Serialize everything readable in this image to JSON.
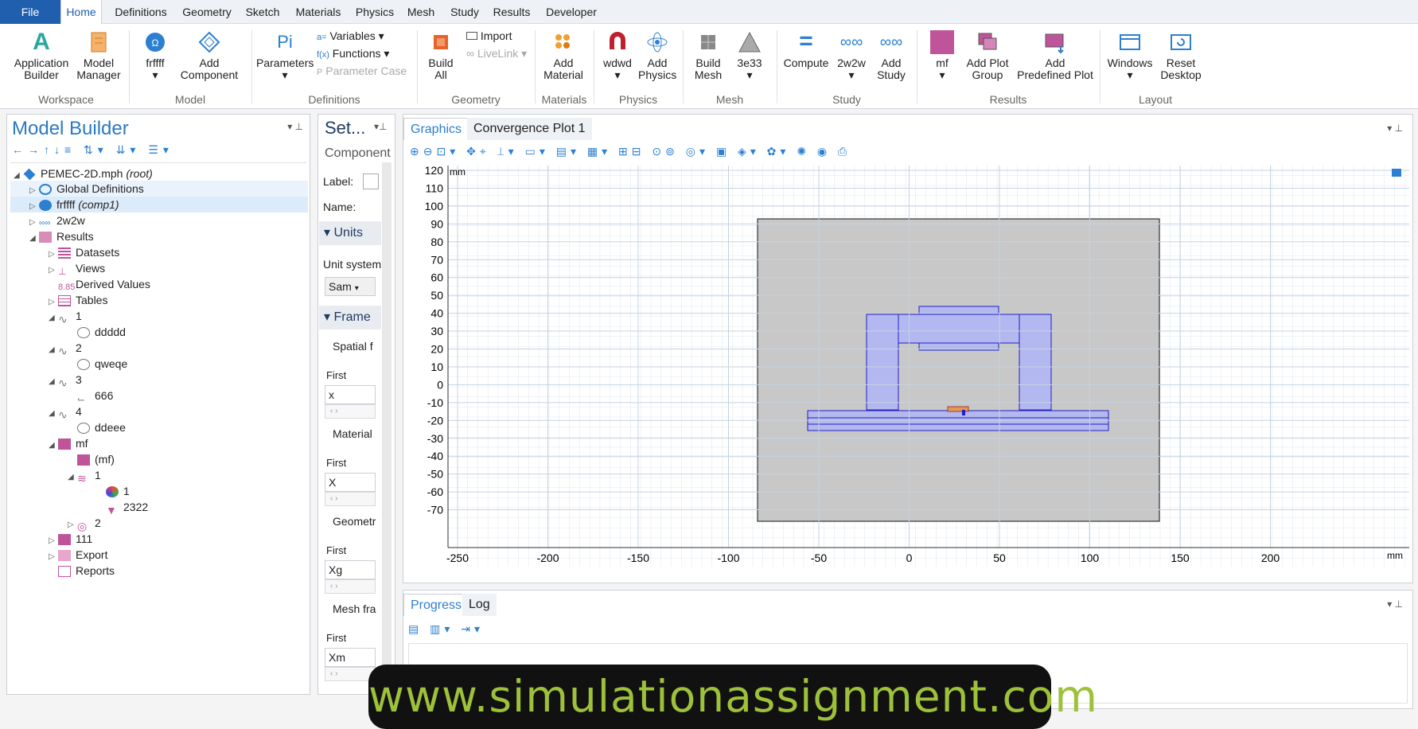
{
  "menu": {
    "tabs": [
      "File",
      "Home",
      "Definitions",
      "Geometry",
      "Sketch",
      "Materials",
      "Physics",
      "Mesh",
      "Study",
      "Results",
      "Developer"
    ]
  },
  "ribbon": {
    "application_builder": "Application\nBuilder",
    "model_manager": "Model\nManager",
    "component_name": "frffff",
    "add_component": "Add\nComponent",
    "parameters": "Parameters",
    "variables": "Variables",
    "functions": "Functions",
    "parameter_case": "Parameter Case",
    "build_all": "Build\nAll",
    "import": "Import",
    "livelink": "LiveLink",
    "add_material": "Add\nMaterial",
    "physics_name": "wdwd",
    "add_physics": "Add\nPhysics",
    "build_mesh": "Build\nMesh",
    "mesh_name": "3e33",
    "compute": "Compute",
    "study_name": "2w2w",
    "add_study": "Add\nStudy",
    "result_name": "mf",
    "add_plot_group": "Add Plot\nGroup",
    "add_predefined_plot": "Add\nPredefined Plot",
    "windows": "Windows",
    "reset_desktop": "Reset\nDesktop",
    "groups": [
      "Workspace",
      "Model",
      "Definitions",
      "Geometry",
      "Materials",
      "Physics",
      "Mesh",
      "Study",
      "Results",
      "Layout"
    ]
  },
  "model_builder": {
    "title": "Model Builder",
    "root_name": "PEMEC-2D.mph",
    "root_tag": "(root)",
    "global_definitions": "Global Definitions",
    "component": "frffff",
    "component_tag": "(comp1)",
    "study": "2w2w",
    "results": "Results",
    "datasets": "Datasets",
    "views": "Views",
    "derived_values": "Derived Values",
    "tables": "Tables",
    "g1": "1",
    "g1c": "ddddd",
    "g2": "2",
    "g2c": "qweqe",
    "g3": "3",
    "g3c": "666",
    "g4": "4",
    "g4c": "ddeee",
    "mf": "mf",
    "mf_child": "(mf)",
    "mf_1": "1",
    "mf_1_1": "1",
    "mf_1_2": "2322",
    "mf_2": "2",
    "g111": "111",
    "export": "Export",
    "reports": "Reports"
  },
  "settings": {
    "title": "Set...",
    "subtitle": "Component",
    "label": "Label:",
    "name": "Name:",
    "units": "Units",
    "unit_system": "Unit system",
    "unit_value": "Sam",
    "frames": "Frame",
    "spatial": "Spatial f",
    "spatial_first": "First",
    "spatial_value": "x",
    "material": "Material",
    "material_first": "First",
    "material_value": "X",
    "geometry": "Geometr",
    "geometry_first": "First",
    "geometry_value": "Xg",
    "mesh": "Mesh fra",
    "mesh_first": "First",
    "mesh_value": "Xm"
  },
  "graphics": {
    "tab_graphics": "Graphics",
    "tab_convergence": "Convergence Plot 1",
    "unit": "mm",
    "x_ticks": [
      "-250",
      "-200",
      "-150",
      "-100",
      "-50",
      "0",
      "50",
      "100",
      "150",
      "200"
    ],
    "y_ticks": [
      "120",
      "110",
      "100",
      "90",
      "80",
      "70",
      "60",
      "50",
      "40",
      "30",
      "20",
      "10",
      "0",
      "-10",
      "-20",
      "-30",
      "-40",
      "-50",
      "-60",
      "-70"
    ]
  },
  "progress": {
    "tab_progress": "Progress",
    "tab_log": "Log"
  },
  "watermark": "www.simulationassignment.com"
}
